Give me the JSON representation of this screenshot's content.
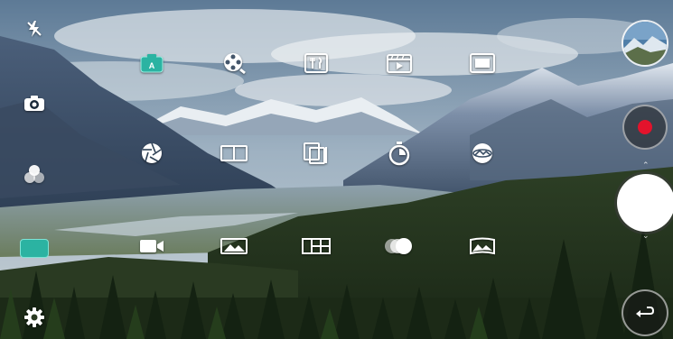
{
  "modes_row1": [
    {
      "id": "auto",
      "icon": "auto-camera-icon",
      "label": "",
      "selected": true
    },
    {
      "id": "slo-mo",
      "icon": "film-reel-icon",
      "label": ""
    },
    {
      "id": "food",
      "icon": "food-utensils-icon",
      "label": ""
    },
    {
      "id": "movie",
      "icon": "clapperboard-play-icon",
      "label": ""
    },
    {
      "id": "frame",
      "icon": "frame-icon",
      "label": ""
    }
  ],
  "modes_row2": [
    {
      "id": "manual-camera",
      "icon": "aperture-icon",
      "label": ""
    },
    {
      "id": "snap",
      "icon": "split-frame-icon",
      "label": ""
    },
    {
      "id": "match-shot",
      "icon": "multi-frame-icon",
      "label": ""
    },
    {
      "id": "time-lapse",
      "icon": "timer-icon",
      "label": ""
    },
    {
      "id": "360-panorama",
      "icon": "panorama-360-icon",
      "label": ""
    }
  ],
  "modes_row3": [
    {
      "id": "manual-video",
      "icon": "video-camera-icon",
      "label": ""
    },
    {
      "id": "photo",
      "icon": "landscape-photo-icon",
      "label": ""
    },
    {
      "id": "grid-shot",
      "icon": "grid-icon",
      "label": ""
    },
    {
      "id": "multi-view",
      "icon": "overlap-circles-icon",
      "label": ""
    },
    {
      "id": "panorama",
      "icon": "panorama-icon",
      "label": ""
    }
  ],
  "left_controls": [
    "flash-off-icon",
    "switch-camera-icon",
    "filter-icon",
    "settings-icon"
  ],
  "right_controls": {
    "gallery": "gallery-thumbnail",
    "record": "record-button",
    "capture": "shutter-button",
    "back": "back-icon"
  },
  "colors": {
    "accent": "#2bb3a2",
    "record": "#e3132c"
  }
}
